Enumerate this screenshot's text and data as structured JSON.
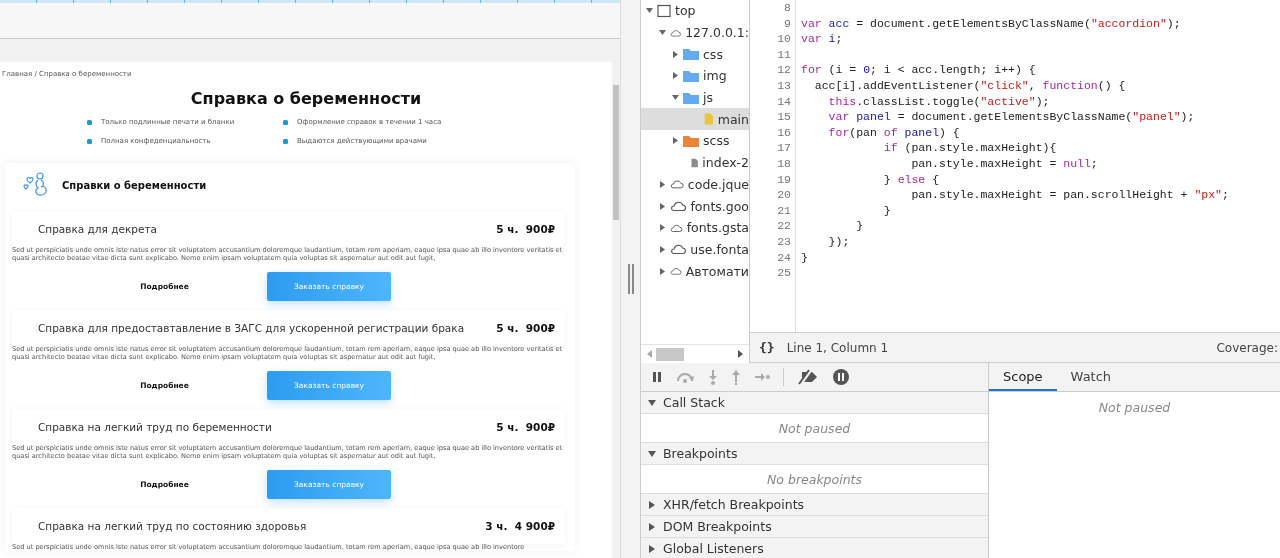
{
  "preview": {
    "breadcrumb": "Главная / Справка о беременности",
    "title": "Справка о беременности",
    "features": [
      "Только подлинные печати и бланки",
      "Оформление справок в течении 1 часа",
      "Полная конфеденциальность",
      "Выдаются действующими врачами"
    ],
    "section": {
      "title": "Справки о беременности",
      "items": [
        {
          "title": "Справка для декрета",
          "price": "5 ч.  900₽",
          "description": "Sed ut perspiciatis unde omnis iste natus error sit voluptatem accusantium doloremque laudantium, totam rem aperiam, eaque ipsa quae ab illo inventore veritatis et quasi architecto beatae vitae dicta sunt explicabo. Nemo enim ipsam voluptatem quia voluptas sit aspernatur aut odit aut fugit,",
          "more_button": "Подробнее",
          "order_button": "Заказать справку"
        },
        {
          "title": "Справка для предоставтавление в ЗАГС для ускоренной регистрации брака",
          "price": "5 ч.  900₽",
          "description": "Sed ut perspiciatis unde omnis iste natus error sit voluptatem accusantium doloremque laudantium, totam rem aperiam, eaque ipsa quae ab illo inventore veritatis et quasi architecto beatae vitae dicta sunt explicabo. Nemo enim ipsam voluptatem quia voluptas sit aspernatur aut odit aut fugit,",
          "more_button": "Подробнее",
          "order_button": "Заказать справку"
        },
        {
          "title": "Справка на легкий труд по беременности",
          "price": "5 ч.  900₽",
          "description": "Sed ut perspiciatis unde omnis iste natus error sit voluptatem accusantium doloremque laudantium, totam rem aperiam, eaque ipsa quae ab illo inventore veritatis et quasi architecto beatae vitae dicta sunt explicabo. Nemo enim ipsam voluptatem quia voluptas sit aspernatur aut odit aut fugit,",
          "more_button": "Подробнее",
          "order_button": "Заказать справку"
        },
        {
          "title": "Справка на легкий труд по состоянию здоровья",
          "price": "3 ч.  4 900₽",
          "description": "Sed ut perspiciatis unde omnis iste natus error sit voluptatem accusantium doloremque laudantium, totam rem aperiam, eaque ipsa quae ab illo inventore"
        }
      ]
    }
  },
  "file_tree": [
    {
      "label": "top",
      "kind": "frame",
      "expanded": true,
      "selected": false,
      "children": [
        {
          "label": "127.0.0.1:",
          "kind": "cloud",
          "expanded": true,
          "selected": false,
          "children": [
            {
              "label": "css",
              "kind": "folder",
              "color": "#64aaf0",
              "expanded": false,
              "selected": false
            },
            {
              "label": "img",
              "kind": "folder",
              "color": "#64aaf0",
              "expanded": false,
              "selected": false
            },
            {
              "label": "js",
              "kind": "folder",
              "color": "#64aaf0",
              "expanded": true,
              "selected": false,
              "children": [
                {
                  "label": "main",
                  "kind": "file",
                  "color": "#e8c440",
                  "selected": true
                }
              ]
            },
            {
              "label": "scss",
              "kind": "folder",
              "color": "#e8853a",
              "expanded": false,
              "selected": false
            },
            {
              "label": "index-2",
              "kind": "file",
              "color": "#8a8a8a",
              "selected": false
            }
          ]
        },
        {
          "label": "code.jque",
          "kind": "cloud",
          "expanded": false,
          "selected": false
        },
        {
          "label": "fonts.goo",
          "kind": "cloud",
          "expanded": false,
          "selected": false
        },
        {
          "label": "fonts.gsta",
          "kind": "cloud",
          "expanded": false,
          "selected": false
        },
        {
          "label": "use.fonta",
          "kind": "cloud",
          "expanded": false,
          "selected": false
        },
        {
          "label": "Автомати",
          "kind": "cloud",
          "expanded": false,
          "selected": false
        }
      ]
    }
  ],
  "editor": {
    "lines": [
      {
        "number": "8"
      },
      {
        "number": "9",
        "tokens": [
          {
            "kind": "keyword",
            "text": "var"
          },
          {
            "kind": "def",
            "text": " acc"
          },
          {
            "kind": "plain",
            "text": " = document.getElementsByClassName("
          },
          {
            "kind": "string",
            "text": "\"accordion\""
          },
          {
            "kind": "plain",
            "text": ");"
          }
        ]
      },
      {
        "number": "10",
        "tokens": [
          {
            "kind": "keyword",
            "text": "var"
          },
          {
            "kind": "def",
            "text": " i"
          },
          {
            "kind": "plain",
            "text": ";"
          }
        ]
      },
      {
        "number": "11"
      },
      {
        "number": "12",
        "tokens": [
          {
            "kind": "keyword",
            "text": "for"
          },
          {
            "kind": "plain",
            "text": " (i = "
          },
          {
            "kind": "number",
            "text": "0"
          },
          {
            "kind": "plain",
            "text": "; i < acc.length; i++) {"
          }
        ]
      },
      {
        "number": "13",
        "tokens": [
          {
            "kind": "plain",
            "text": "  acc[i].addEventListener("
          },
          {
            "kind": "string",
            "text": "\"click\""
          },
          {
            "kind": "plain",
            "text": ", "
          },
          {
            "kind": "keyword",
            "text": "function"
          },
          {
            "kind": "plain",
            "text": "() {"
          }
        ]
      },
      {
        "number": "14",
        "tokens": [
          {
            "kind": "keyword",
            "text": "    this"
          },
          {
            "kind": "plain",
            "text": ".classList.toggle("
          },
          {
            "kind": "string",
            "text": "\"active\""
          },
          {
            "kind": "plain",
            "text": ");"
          }
        ]
      },
      {
        "number": "15",
        "tokens": [
          {
            "kind": "keyword",
            "text": "    var"
          },
          {
            "kind": "def",
            "text": " panel"
          },
          {
            "kind": "plain",
            "text": " = document.getElementsByClassName("
          },
          {
            "kind": "string",
            "text": "\"panel\""
          },
          {
            "kind": "plain",
            "text": ");"
          }
        ]
      },
      {
        "number": "16",
        "tokens": [
          {
            "kind": "keyword",
            "text": "    for"
          },
          {
            "kind": "plain",
            "text": "(pan "
          },
          {
            "kind": "keyword",
            "text": "of"
          },
          {
            "kind": "def",
            "text": " panel"
          },
          {
            "kind": "plain",
            "text": ") {"
          }
        ]
      },
      {
        "number": "17",
        "tokens": [
          {
            "kind": "keyword",
            "text": "            if"
          },
          {
            "kind": "plain",
            "text": " (pan.style.maxHeight){"
          }
        ]
      },
      {
        "number": "18",
        "tokens": [
          {
            "kind": "plain",
            "text": "                pan.style.maxHeight = "
          },
          {
            "kind": "keyword",
            "text": "null"
          },
          {
            "kind": "plain",
            "text": ";"
          }
        ]
      },
      {
        "number": "19",
        "tokens": [
          {
            "kind": "plain",
            "text": "            } "
          },
          {
            "kind": "keyword",
            "text": "else"
          },
          {
            "kind": "plain",
            "text": " {"
          }
        ]
      },
      {
        "number": "20",
        "tokens": [
          {
            "kind": "plain",
            "text": "                pan.style.maxHeight = pan.scrollHeight + "
          },
          {
            "kind": "string",
            "text": "\"px\""
          },
          {
            "kind": "plain",
            "text": ";"
          }
        ]
      },
      {
        "number": "21",
        "tokens": [
          {
            "kind": "plain",
            "text": "            }"
          }
        ]
      },
      {
        "number": "22",
        "tokens": [
          {
            "kind": "plain",
            "text": "        }"
          }
        ]
      },
      {
        "number": "23",
        "tokens": [
          {
            "kind": "plain",
            "text": "    });"
          }
        ]
      },
      {
        "number": "24",
        "tokens": [
          {
            "kind": "plain",
            "text": "}"
          }
        ]
      },
      {
        "number": "25"
      }
    ],
    "status": {
      "format_button": "{}",
      "position": "Line 1, Column 1",
      "coverage": "Coverage:"
    }
  },
  "debugger": {
    "sections": [
      {
        "title": "Call Stack",
        "expanded": true,
        "message": "Not paused"
      },
      {
        "title": "Breakpoints",
        "expanded": true,
        "message": "No breakpoints"
      },
      {
        "title": "XHR/fetch Breakpoints",
        "expanded": false
      },
      {
        "title": "DOM Breakpoints",
        "expanded": false
      },
      {
        "title": "Global Listeners",
        "expanded": false
      }
    ],
    "tabs": [
      {
        "label": "Scope",
        "selected": true
      },
      {
        "label": "Watch",
        "selected": false
      }
    ],
    "scope_message": "Not paused"
  }
}
